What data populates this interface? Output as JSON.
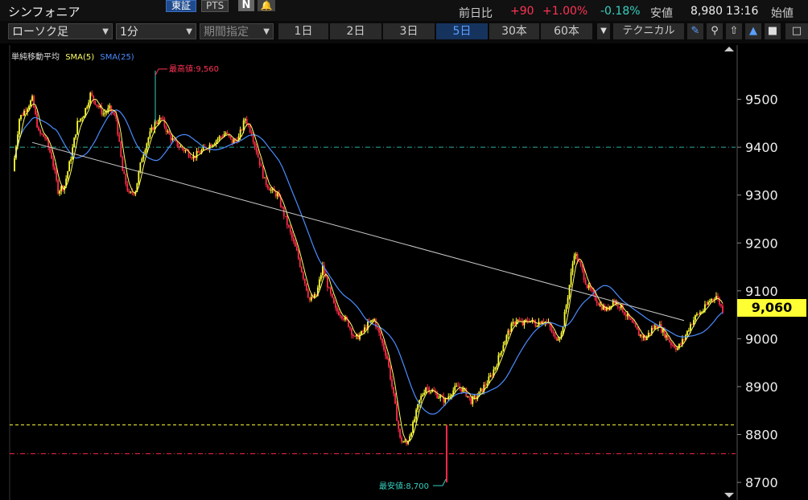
{
  "header": {
    "title": "シンフォニア",
    "exchange": "東証",
    "pts": "PTS",
    "news": "N",
    "bell_icon": "bell-icon",
    "prev_label": "前日比",
    "change": "+90",
    "change_pct": "+1.00%",
    "low_change_pct": "-0.18%",
    "low_label": "安値",
    "low_value": "8,980",
    "time": "13:16",
    "open_label": "始値"
  },
  "toolbar": {
    "chart_type": "ローソク足",
    "interval": "1分",
    "period": "期間指定",
    "timeframes": [
      "1日",
      "2日",
      "3日",
      "5日",
      "30本",
      "60本"
    ],
    "active_timeframe": "5日",
    "technical": "テクニカル",
    "icons": [
      "pencil-icon",
      "zoom-icon",
      "export-icon",
      "area-chart-icon",
      "save-icon",
      "copy-icon"
    ]
  },
  "legend": {
    "name": "単純移動平均",
    "sma5": "SMA(5)",
    "sma25": "SMA(25)"
  },
  "colors": {
    "up": "#ffff33",
    "down": "#ff2a4a",
    "sma5": "#ffff66",
    "sma25": "#4a8cff",
    "positive": "#ff3355",
    "negative": "#36d0c0",
    "accent": "#5aa0ff"
  },
  "chart_data": {
    "type": "candlestick",
    "ylim": [
      8680,
      9600
    ],
    "yticks": [
      8700,
      8800,
      8900,
      9000,
      9100,
      9200,
      9300,
      9400,
      9500
    ],
    "current_price": "9,060",
    "high_annotation": "最高値:9,560",
    "low_annotation": "最安値:8,700",
    "high_value": 9560,
    "low_value": 8700,
    "hlines": [
      {
        "value": 9400,
        "color": "#2ab0a0",
        "style": "dash-dot"
      },
      {
        "value": 8820,
        "color": "#ffff33",
        "style": "dashed"
      },
      {
        "value": 8760,
        "color": "#ff2a4a",
        "style": "dash-dot"
      }
    ],
    "trendline": {
      "start": 9410,
      "end": 9038
    },
    "price_path": [
      9350,
      9460,
      9480,
      9500,
      9430,
      9420,
      9380,
      9310,
      9320,
      9380,
      9450,
      9470,
      9510,
      9490,
      9470,
      9480,
      9460,
      9350,
      9300,
      9310,
      9380,
      9420,
      9450,
      9460,
      9430,
      9410,
      9400,
      9390,
      9380,
      9390,
      9400,
      9410,
      9420,
      9430,
      9410,
      9420,
      9460,
      9430,
      9380,
      9330,
      9310,
      9300,
      9260,
      9220,
      9180,
      9130,
      9080,
      9090,
      9150,
      9100,
      9060,
      9050,
      9030,
      9000,
      9010,
      9030,
      9040,
      9000,
      8960,
      8880,
      8790,
      8780,
      8820,
      8870,
      8900,
      8890,
      8880,
      8870,
      8890,
      8900,
      8890,
      8870,
      8880,
      8900,
      8920,
      8950,
      8990,
      9020,
      9040,
      9030,
      9040,
      9030,
      9040,
      9030,
      9000,
      9010,
      9090,
      9180,
      9150,
      9110,
      9090,
      9070,
      9060,
      9080,
      9070,
      9050,
      9030,
      9010,
      9000,
      9020,
      9030,
      9010,
      8990,
      8980,
      9000,
      9030,
      9050,
      9060,
      9080,
      9090,
      9060
    ]
  }
}
